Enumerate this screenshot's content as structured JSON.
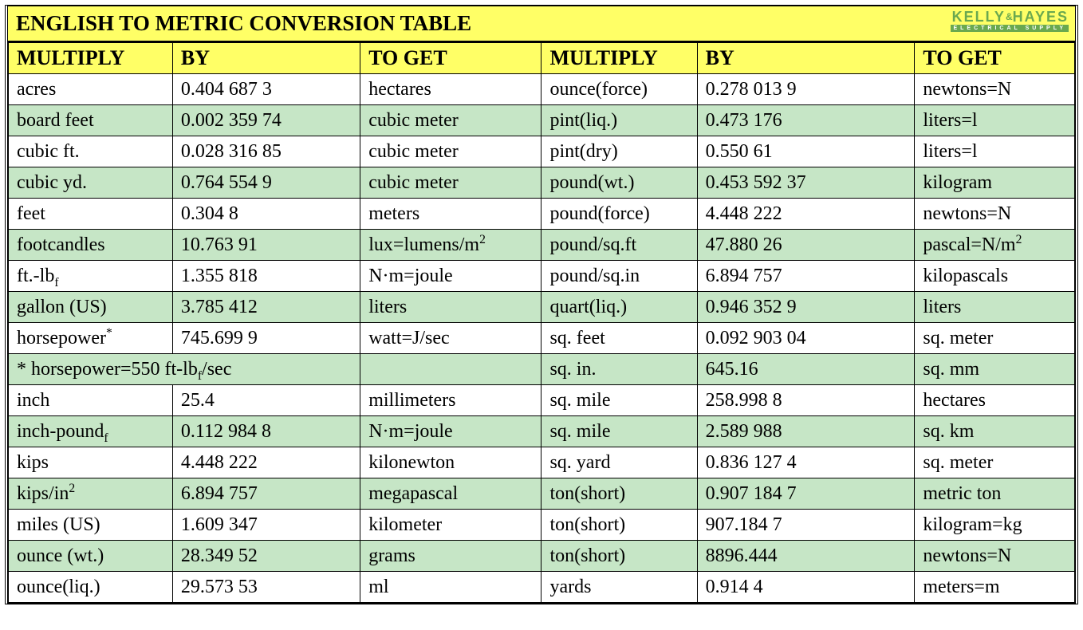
{
  "title": "ENGLISH TO METRIC CONVERSION TABLE",
  "brand": {
    "name_a": "KELLY",
    "amp": "&",
    "name_b": "HAYES",
    "sub": "ELECTRICAL SUPPLY"
  },
  "headers": [
    "MULTIPLY",
    "BY",
    " TO GET",
    "MULTIPLY",
    " BY",
    " TO GET"
  ],
  "rows": [
    {
      "c": "plain",
      "cells": [
        "acres",
        "0.404 687 3",
        "hectares",
        "ounce(force)",
        "0.278 013 9",
        "newtons=N"
      ]
    },
    {
      "c": "alt",
      "cells": [
        "board feet",
        "0.002 359 74",
        "cubic meter",
        "pint(liq.)",
        "0.473 176",
        "liters=l"
      ]
    },
    {
      "c": "plain",
      "cells": [
        "cubic ft.",
        "0.028 316 85",
        "cubic meter",
        "pint(dry)",
        "0.550 61",
        "liters=l"
      ]
    },
    {
      "c": "alt",
      "cells": [
        "cubic yd.",
        "0.764 554 9",
        "cubic meter",
        "pound(wt.)",
        "0.453 592 37",
        "kilogram"
      ]
    },
    {
      "c": "plain",
      "cells": [
        "feet",
        "0.304 8",
        "meters",
        "pound(force)",
        "4.448 222",
        "newtons=N"
      ]
    },
    {
      "c": "alt",
      "cells": [
        "footcandles",
        "10.763 91",
        "lux=lumens/m<sup>2</sup>",
        "pound/sq.ft",
        "47.880 26",
        "pascal=N/m<sup>2</sup>"
      ]
    },
    {
      "c": "plain",
      "cells": [
        "ft.-lb<sub>f</sub>",
        "1.355 818",
        "N·m=joule",
        "pound/sq.in",
        "6.894 757",
        "kilopascals"
      ]
    },
    {
      "c": "alt",
      "cells": [
        "gallon (US)",
        "3.785 412",
        "liters",
        "quart(liq.)",
        "0.946 352 9",
        "liters"
      ]
    },
    {
      "c": "plain",
      "cells": [
        "horsepower<sup>*</sup>",
        "745.699 9",
        "watt=J/sec",
        "sq. feet",
        "0.092 903 04",
        "sq. meter"
      ]
    },
    {
      "c": "alt",
      "span": true,
      "cells": [
        "* horsepower=550 ft-lb<sub>f</sub>/sec",
        "",
        "sq. in.",
        "645.16",
        "sq. mm"
      ]
    },
    {
      "c": "plain",
      "cells": [
        "inch",
        "25.4",
        "millimeters",
        "sq. mile",
        "258.998 8",
        "hectares"
      ]
    },
    {
      "c": "alt",
      "cells": [
        "inch-pound<sub>f</sub>",
        "0.112 984 8",
        "N·m=joule",
        "sq. mile",
        "2.589 988",
        "sq. km"
      ]
    },
    {
      "c": "plain",
      "cells": [
        "kips",
        "4.448 222",
        "kilonewton",
        "sq. yard",
        "0.836 127 4",
        "sq. meter"
      ]
    },
    {
      "c": "alt",
      "cells": [
        "kips/in<sup>2</sup>",
        "6.894 757",
        "megapascal",
        "ton(short)",
        "0.907 184 7",
        "metric ton"
      ]
    },
    {
      "c": "plain",
      "cells": [
        "miles (US)",
        "1.609 347",
        "kilometer",
        "ton(short)",
        "907.184 7",
        "kilogram=kg"
      ]
    },
    {
      "c": "alt",
      "cells": [
        "ounce (wt.)",
        "28.349 52",
        "grams",
        "ton(short)",
        "8896.444",
        "newtons=N"
      ]
    },
    {
      "c": "plain",
      "cells": [
        "ounce(liq.)",
        "29.573 53",
        "ml",
        "yards",
        "0.914 4",
        "meters=m"
      ]
    }
  ]
}
